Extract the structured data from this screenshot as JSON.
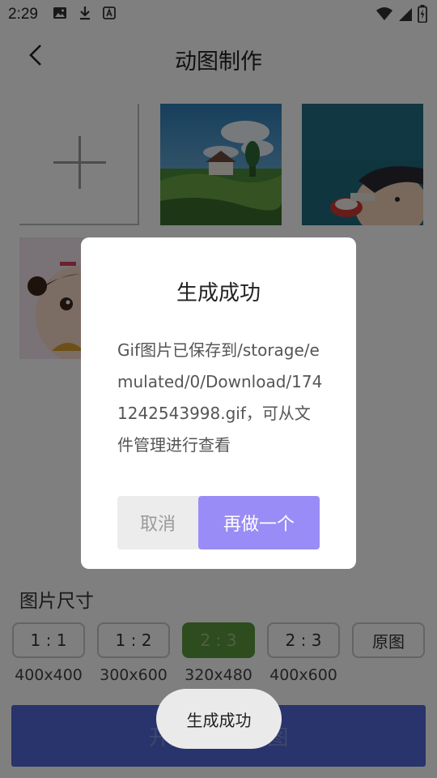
{
  "status_bar": {
    "time": "2:29",
    "left_icons": [
      "image-icon",
      "download-icon",
      "text-a-icon"
    ],
    "right_icons": [
      "wifi-icon",
      "signal-icon",
      "battery-charging-icon"
    ]
  },
  "app_bar": {
    "title": "动图制作",
    "back_icon": "chevron-left-icon"
  },
  "images": {
    "add_icon": "plus-icon",
    "thumbnails": [
      "landscape-thumbnail",
      "boy-drinking-thumbnail",
      "girl-doll-thumbnail"
    ]
  },
  "size_section": {
    "label": "图片尺寸",
    "options": [
      {
        "ratio": "1 : 1",
        "dims": "400x400",
        "selected": false
      },
      {
        "ratio": "1 : 2",
        "dims": "300x600",
        "selected": false
      },
      {
        "ratio": "2 : 3",
        "dims": "320x480",
        "selected": true
      },
      {
        "ratio": "2 : 3",
        "dims": "400x600",
        "selected": false
      },
      {
        "ratio": "原图",
        "dims": "",
        "selected": false
      }
    ]
  },
  "start_button": {
    "label": "开始生成GIF图"
  },
  "dialog": {
    "title": "生成成功",
    "message": "Gif图片已保存到/storage/emulated/0/Download/1741242543998.gif，可从文件管理进行查看",
    "cancel_label": "取消",
    "again_label": "再做一个"
  },
  "toast": {
    "text": "生成成功"
  },
  "colors": {
    "accent": "#9a8cf6",
    "selected_option": "#5c9a3d",
    "start_button": "#5366d8"
  }
}
